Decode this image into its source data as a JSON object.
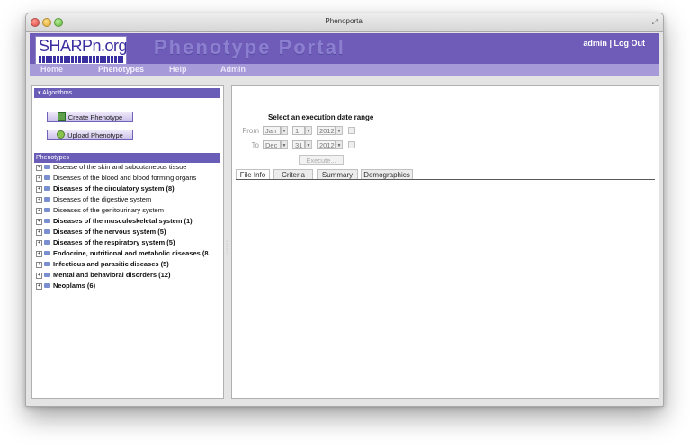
{
  "window": {
    "title": "Phenoportal"
  },
  "header": {
    "logo_text": "SHARPn.org",
    "title": "Phenotype Portal",
    "user": "admin",
    "separator": "|",
    "logout": "Log Out"
  },
  "nav": {
    "items": [
      "Home",
      "Phenotypes",
      "Help",
      "Admin"
    ]
  },
  "left": {
    "algorithms_header": "Algorithms",
    "create_button": "Create Phenotype",
    "upload_button": "Upload Phenotype",
    "phenotypes_header": "Phenotypes",
    "tree": [
      {
        "label": "Disease of the skin and subcutaneous tissue"
      },
      {
        "label": "Diseases of the blood and blood forming organs"
      },
      {
        "label": "Diseases of the circulatory system (8)"
      },
      {
        "label": "Diseases of the digestive system"
      },
      {
        "label": "Diseases of the genitourinary system"
      },
      {
        "label": "Diseases of the musculoskeletal system (1)"
      },
      {
        "label": "Diseases of the nervous system (5)"
      },
      {
        "label": "Diseases of the respiratory system (5)"
      },
      {
        "label": "Endocrine, nutritional and metabolic diseases (8"
      },
      {
        "label": "Infectious and parasitic diseases (5)"
      },
      {
        "label": "Mental and behavioral disorders (12)"
      },
      {
        "label": "Neoplams (6)"
      }
    ]
  },
  "execution": {
    "title": "Select an execution date range",
    "from_label": "From",
    "to_label": "To",
    "from_month": "Jan",
    "from_day": "1",
    "from_year": "2012",
    "to_month": "Dec",
    "to_day": "31",
    "to_year": "2012",
    "execute_button": "Execute..."
  },
  "tabs": [
    "File Info",
    "Criteria",
    "Summary",
    "Demographics"
  ],
  "colors": {
    "header": "#6e5cb8",
    "nav": "#a69ad8",
    "section": "#6a5db7"
  }
}
